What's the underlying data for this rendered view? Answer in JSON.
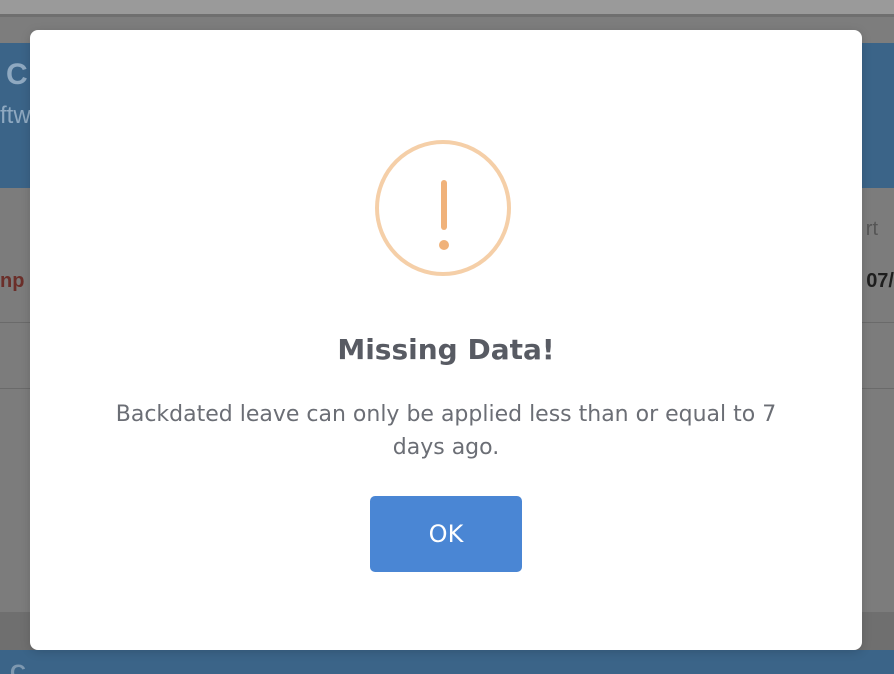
{
  "background": {
    "header_title": "C",
    "header_subtitle": "ftw",
    "left_red_text": "np",
    "right_label": "rt",
    "right_date": "07/",
    "bottom_text": "C"
  },
  "dialog": {
    "title": "Missing Data!",
    "message": "Backdated leave can only be applied less than or equal to 7 days ago.",
    "ok_label": "OK",
    "icon": "warning-exclamation-icon"
  },
  "colors": {
    "header_blue": "#3b6488",
    "button_blue": "#4a86d4",
    "warning_orange": "#f0b27a"
  }
}
